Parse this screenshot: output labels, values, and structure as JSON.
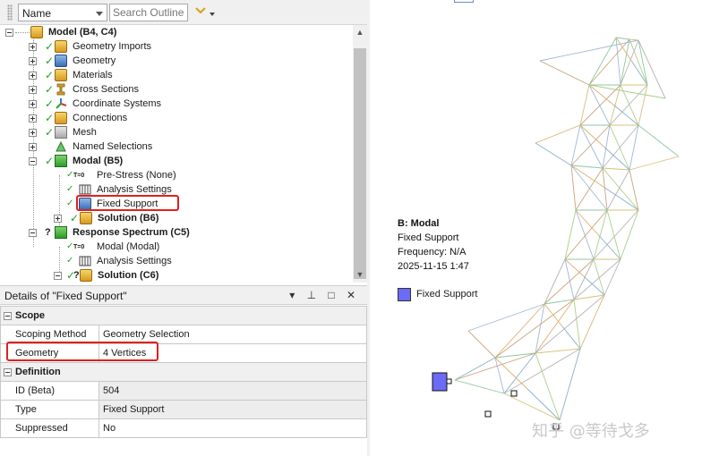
{
  "toolbar": {
    "filter_select": "Name",
    "search_placeholder": "Search Outline"
  },
  "tree": {
    "root": "Model (B4, C4)",
    "items": [
      {
        "label": "Geometry Imports"
      },
      {
        "label": "Geometry"
      },
      {
        "label": "Materials"
      },
      {
        "label": "Cross Sections"
      },
      {
        "label": "Coordinate Systems"
      },
      {
        "label": "Connections"
      },
      {
        "label": "Mesh"
      },
      {
        "label": "Named Selections"
      }
    ],
    "modal": {
      "label": "Modal (B5)",
      "children": [
        {
          "label": "Pre-Stress (None)",
          "prefix": "T=0"
        },
        {
          "label": "Analysis Settings"
        },
        {
          "label": "Fixed Support"
        },
        {
          "label": "Solution (B6)"
        }
      ]
    },
    "response": {
      "label": "Response Spectrum (C5)",
      "children": [
        {
          "label": "Modal (Modal)",
          "prefix": "T=0"
        },
        {
          "label": "Analysis Settings"
        },
        {
          "label": "Solution (C6)"
        }
      ]
    }
  },
  "details": {
    "title": "Details of \"Fixed Support\"",
    "header_buttons": "▾ ⊥ □ ✕",
    "sections": [
      {
        "name": "Scope",
        "rows": [
          {
            "key": "Scoping Method",
            "value": "Geometry Selection"
          },
          {
            "key": "Geometry",
            "value": "4 Vertices"
          }
        ]
      },
      {
        "name": "Definition",
        "rows": [
          {
            "key": "ID (Beta)",
            "value": "504"
          },
          {
            "key": "Type",
            "value": "Fixed Support"
          },
          {
            "key": "Suppressed",
            "value": "No"
          }
        ]
      }
    ]
  },
  "viewport": {
    "title": "B: Modal",
    "line1": "Fixed Support",
    "line2": "Frequency: N/A",
    "line3": "2025-11-15 1:47",
    "legend_label": "Fixed Support",
    "legend_color": "#6b6bf5",
    "watermark": "知乎 @等待戈多"
  },
  "colors": {
    "highlight": "#e0201c",
    "check": "#24a124",
    "panel_bg": "#f0f0f0"
  }
}
